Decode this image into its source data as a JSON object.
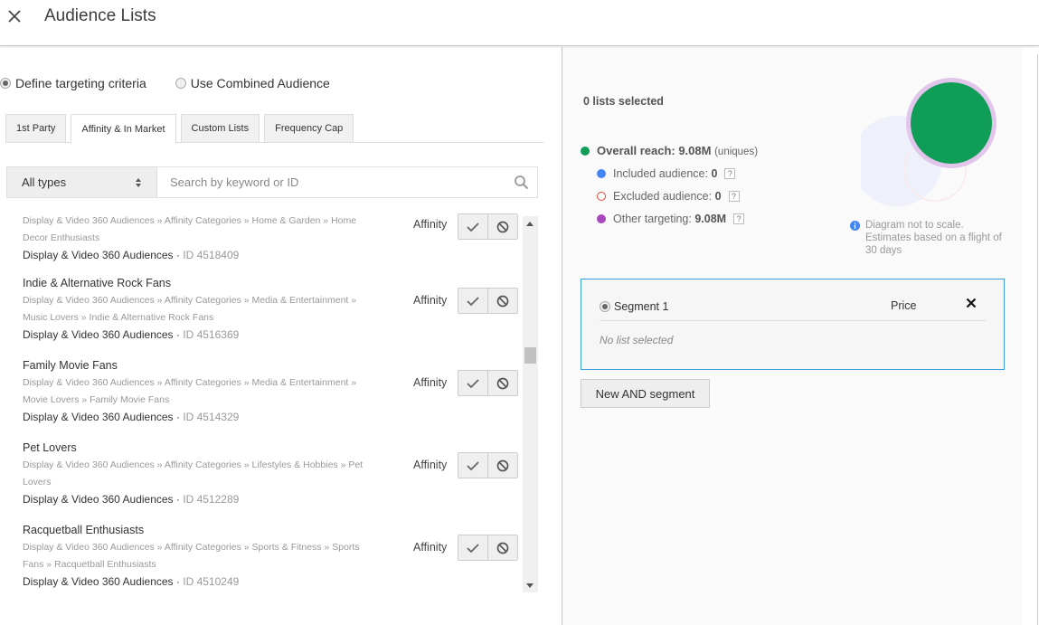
{
  "header": {
    "title": "Audience Lists",
    "close_icon": "close-icon"
  },
  "targeting_mode": {
    "options": [
      {
        "label": "Define targeting criteria",
        "selected": true
      },
      {
        "label": "Use Combined Audience",
        "selected": false
      }
    ]
  },
  "tabs": [
    {
      "label": "1st Party",
      "active": false
    },
    {
      "label": "Affinity & In Market",
      "active": true
    },
    {
      "label": "Custom Lists",
      "active": false
    },
    {
      "label": "Frequency Cap",
      "active": false
    }
  ],
  "filter": {
    "type_select": "All types",
    "search_placeholder": "Search by keyword or ID",
    "search_value": ""
  },
  "list_items": [
    {
      "name": "",
      "path": "Display & Video 360 Audiences » Affinity Categories » Home & Garden » Home Decor Enthusiasts",
      "source": "Display & Video 360 Audiences",
      "id": "ID 4518409",
      "type": "Affinity"
    },
    {
      "name": "Indie & Alternative Rock Fans",
      "path": "Display & Video 360 Audiences » Affinity Categories » Media & Entertainment » Music Lovers » Indie & Alternative Rock Fans",
      "source": "Display & Video 360 Audiences",
      "id": "ID 4516369",
      "type": "Affinity"
    },
    {
      "name": "Family Movie Fans",
      "path": "Display & Video 360 Audiences » Affinity Categories » Media & Entertainment » Movie Lovers » Family Movie Fans",
      "source": "Display & Video 360 Audiences",
      "id": "ID 4514329",
      "type": "Affinity"
    },
    {
      "name": "Pet Lovers",
      "path": "Display & Video 360 Audiences » Affinity Categories » Lifestyles & Hobbies » Pet Lovers",
      "source": "Display & Video 360 Audiences",
      "id": "ID 4512289",
      "type": "Affinity"
    },
    {
      "name": "Racquetball Enthusiasts",
      "path": "Display & Video 360 Audiences » Affinity Categories » Sports & Fitness » Sports Fans » Racquetball Enthusiasts",
      "source": "Display & Video 360 Audiences",
      "id": "ID 4510249",
      "type": "Affinity"
    }
  ],
  "source_separator": " · ",
  "summary": {
    "lists_selected": "0 lists selected",
    "overall_reach_label": "Overall reach: 9.08M",
    "overall_reach_suffix": "(uniques)",
    "included_label": "Included audience:",
    "included_value": "0",
    "excluded_label": "Excluded audience:",
    "excluded_value": "0",
    "other_label": "Other targeting:",
    "other_value": "9.08M",
    "help_glyph": "?",
    "note": "Diagram not to scale. Estimates based on a flight of 30 days",
    "colors": {
      "overall": "#0f9d58",
      "included": "#4285f4",
      "excluded": "#e8453c",
      "other": "#ab47bc",
      "segment_border": "#3b9de0"
    }
  },
  "segment": {
    "label": "Segment 1",
    "price_label": "Price",
    "empty_text": "No list selected"
  },
  "new_segment_button": "New AND segment"
}
